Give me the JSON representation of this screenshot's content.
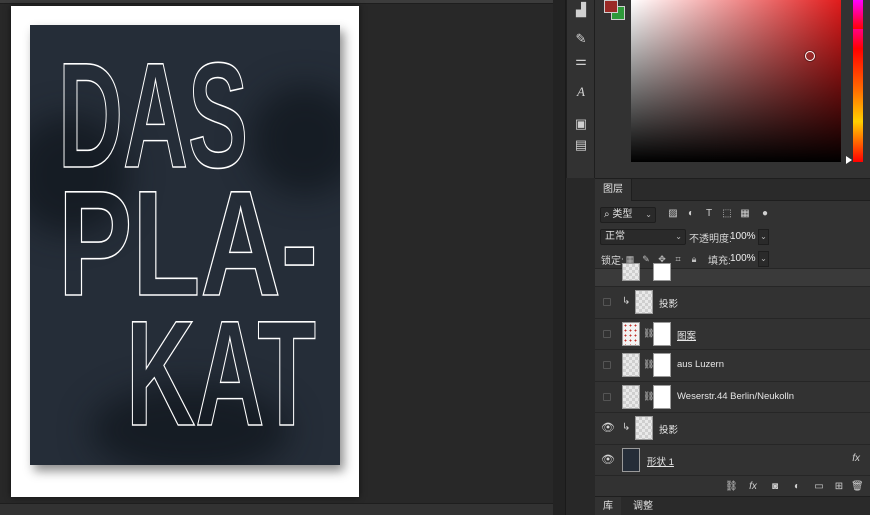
{
  "poster": {
    "lines": [
      "DAS",
      "PLA-",
      "KAT"
    ],
    "text_color": "#ffffff",
    "background_color": "#252d38"
  },
  "colors": {
    "foreground": "#9a2a26",
    "background": "#2e9a3a"
  },
  "layers_panel": {
    "tab": "图层",
    "filter_kind": "类型",
    "blend_mode": "正常",
    "opacity_label": "不透明度:",
    "opacity_value": "100%",
    "lock_label": "锁定:",
    "fill_label": "填充:",
    "fill_value": "100%",
    "layers": [
      {
        "name": "投影",
        "visible": false,
        "clipped": true,
        "thumb": "transparent",
        "mask": false
      },
      {
        "name": "图案",
        "visible": false,
        "clipped": false,
        "thumb": "pattern",
        "mask": true,
        "underline": true
      },
      {
        "name": "aus Luzern",
        "visible": false,
        "clipped": false,
        "thumb": "transparent",
        "mask": true
      },
      {
        "name": "Weserstr.44 Berlin/Neukolln",
        "visible": false,
        "clipped": false,
        "thumb": "transparent",
        "mask": true
      },
      {
        "name": "投影",
        "visible": true,
        "clipped": true,
        "thumb": "transparent",
        "mask": false
      },
      {
        "name": "形状 1",
        "visible": true,
        "clipped": false,
        "thumb": "dark",
        "mask": false,
        "fx": "fx",
        "underline": true
      }
    ]
  },
  "bottom_tabs": [
    "库",
    "调整"
  ]
}
